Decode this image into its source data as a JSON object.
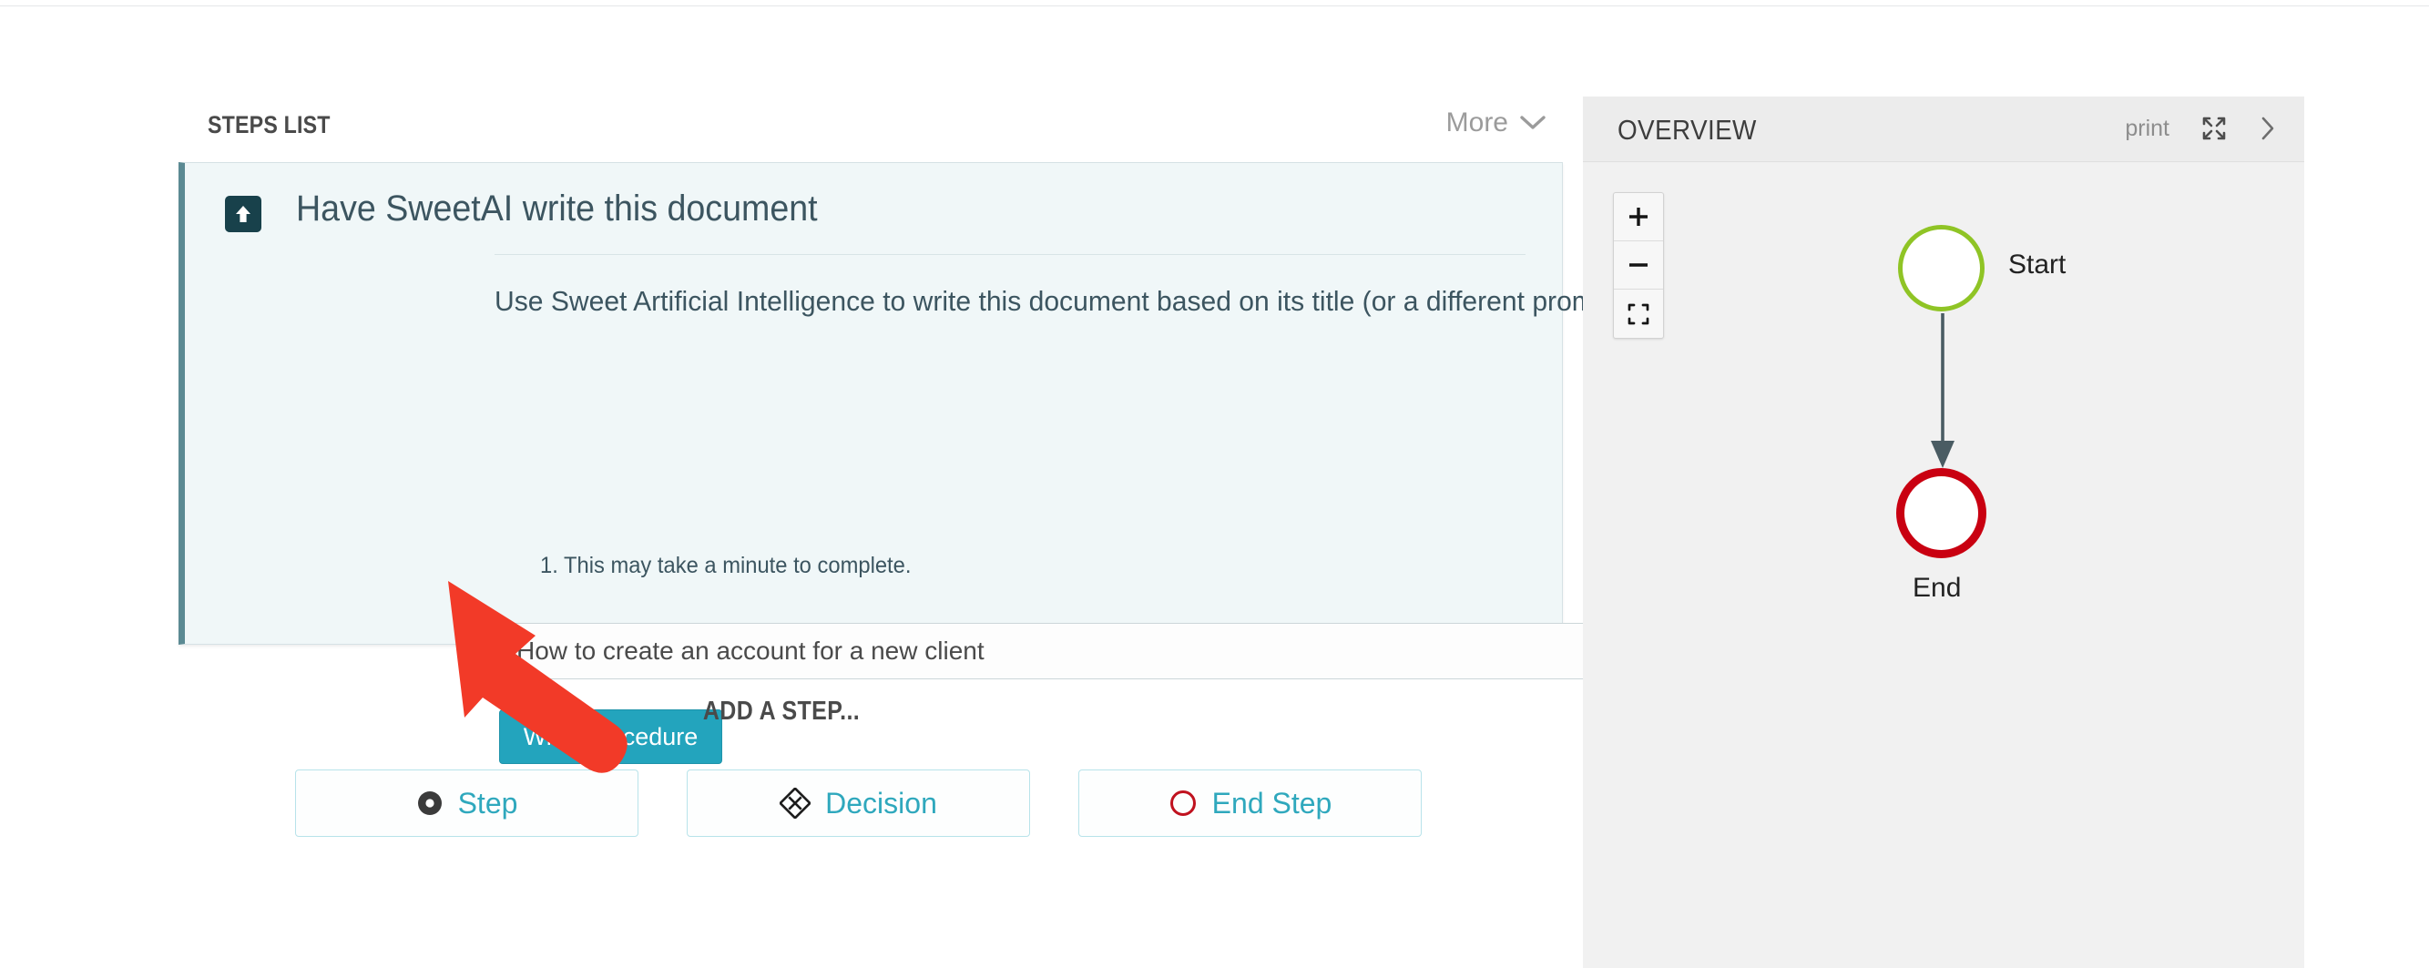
{
  "steps_panel": {
    "title": "STEPS LIST",
    "more_label": "More",
    "more_icon": "chevron-down-icon"
  },
  "step_card": {
    "icon": "arrow-up-box-icon",
    "title": "Have SweetAI write this document",
    "description": "Use Sweet Artificial Intelligence to write this document based on its title (or a different prompt).",
    "notes": [
      "1. This may take a minute to complete."
    ],
    "prompt_input": {
      "value": "How to create an account for a new client",
      "placeholder": "How to create an account for a new client"
    },
    "write_button_label": "Write procedure",
    "accent_color": "#5b8a93",
    "background_color": "#f0f7f8",
    "button_color": "#23a4bd"
  },
  "add_step": {
    "label": "ADD A STEP...",
    "buttons": [
      {
        "label": "Step",
        "icon": "filled-circle-icon",
        "icon_color": "#3b3b3b"
      },
      {
        "label": "Decision",
        "icon": "diamond-decision-icon",
        "icon_color": "#1c1c1c"
      },
      {
        "label": "End Step",
        "icon": "red-circle-outline-icon",
        "icon_color": "#c0121f"
      }
    ],
    "text_color": "#2fa8bd",
    "border_color": "#b8e3ea"
  },
  "annotation": {
    "type": "pointer-arrow",
    "color": "#f23a28",
    "points_at": "Write procedure"
  },
  "overview_panel": {
    "title": "OVERVIEW",
    "print_label": "print",
    "expand_icon": "expand-fullscreen-icon",
    "collapse_icon": "chevron-right-icon",
    "zoom_controls": [
      {
        "label": "+",
        "icon": "zoom-in-icon"
      },
      {
        "label": "−",
        "icon": "zoom-out-icon"
      },
      {
        "label": "",
        "icon": "fit-to-screen-icon"
      }
    ]
  },
  "chart_data": {
    "type": "diagram",
    "title": "OVERVIEW",
    "nodes": [
      {
        "id": "start",
        "label": "Start",
        "shape": "circle",
        "stroke": "#8fc425",
        "fill": "#ffffff",
        "label_position": "right"
      },
      {
        "id": "end",
        "label": "End",
        "shape": "circle",
        "stroke": "#c90011",
        "fill": "#ffffff",
        "label_position": "below"
      }
    ],
    "edges": [
      {
        "from": "start",
        "to": "end",
        "style": "solid-arrow",
        "color": "#4a5c63"
      }
    ]
  }
}
